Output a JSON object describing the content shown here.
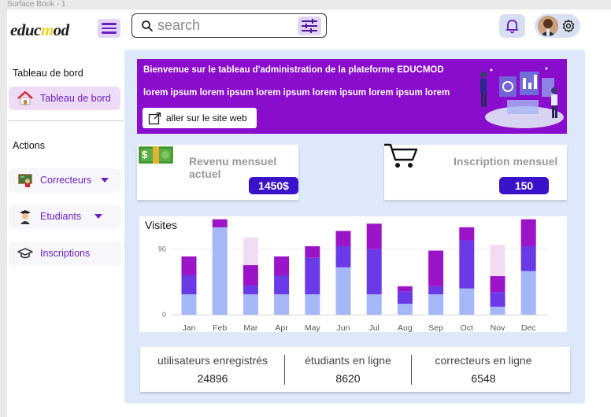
{
  "frame": {
    "title": "Surface Book - 1"
  },
  "header": {
    "logo_part1": "educ",
    "logo_part2": "m",
    "logo_part3": "od",
    "search_placeholder": "search"
  },
  "sidebar": {
    "dashboard_heading": "Tableau de bord",
    "dashboard_item": "Tableau de bord",
    "actions_heading": "Actions",
    "items": [
      {
        "label": "Correcteurs"
      },
      {
        "label": "Etudiants"
      },
      {
        "label": "Inscriptions"
      }
    ]
  },
  "banner": {
    "title": "Bienvenue sur le tableau d'administration de la plateforme EDUCMOD",
    "subtitle": "lorem ipsum lorem ipsum  lorem ipsum lorem ipsum lorem ipsum lorem",
    "button_label": "aller sur le site web"
  },
  "cards": {
    "revenue": {
      "title": "Revenu mensuel actuel",
      "value": "1450$"
    },
    "signup": {
      "title": "Inscription mensuel",
      "value": "150"
    }
  },
  "chart_data": {
    "type": "bar",
    "title": "Visites",
    "categories": [
      "Jan",
      "Feb",
      "Mar",
      "Apr",
      "May",
      "Jun",
      "Jul",
      "Aug",
      "Sep",
      "Oct",
      "Nov",
      "Dec"
    ],
    "y_ticks": [
      0,
      90
    ],
    "ylim": [
      0,
      135
    ],
    "series": [
      {
        "values": [
          28,
          120,
          28,
          28,
          28,
          65,
          28,
          15,
          28,
          36,
          11,
          60
        ]
      },
      {
        "values": [
          26,
          0,
          12,
          26,
          50,
          29,
          62,
          17,
          11,
          66,
          20,
          34
        ]
      },
      {
        "values": [
          26,
          11,
          28,
          26,
          16,
          21,
          35,
          7,
          49,
          18,
          22,
          37
        ]
      },
      {
        "values": [
          0,
          0,
          38,
          0,
          0,
          0,
          0,
          0,
          0,
          0,
          43,
          0
        ]
      }
    ],
    "colors": [
      "#a6b7f7",
      "#6a3ae6",
      "#9b14c8",
      "#f2dcf2"
    ]
  },
  "stats": [
    {
      "label": "utilisateurs enregistrés",
      "value": "24896"
    },
    {
      "label": "étudiants en ligne",
      "value": "8620"
    },
    {
      "label": "correcteurs en  ligne",
      "value": "6548"
    }
  ]
}
